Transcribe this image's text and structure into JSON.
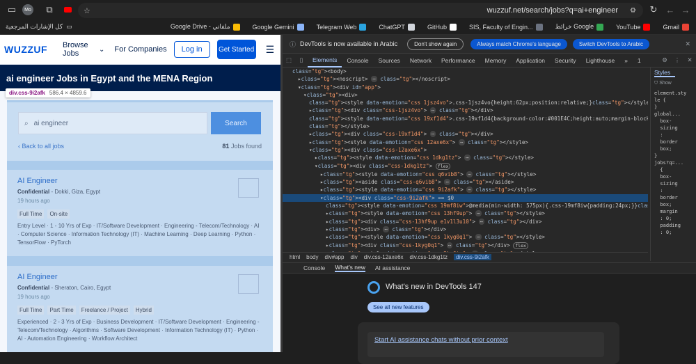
{
  "browser": {
    "url": "wuzzuf.net/search/jobs?q=ai+engineer",
    "bookmarks": [
      {
        "label": "Gmail",
        "color": "#ea4335"
      },
      {
        "label": "YouTube",
        "color": "#ff0000"
      },
      {
        "label": "خرائط Google",
        "color": "#34a853"
      },
      {
        "label": "SIS, Faculty of Engin...",
        "color": "#6b7280"
      },
      {
        "label": "GitHub",
        "color": "#ffffff"
      },
      {
        "label": "ChatGPT",
        "color": "#d1d5db"
      },
      {
        "label": "Telegram Web",
        "color": "#2aa3df"
      },
      {
        "label": "Google Gemini",
        "color": "#8ab4f8"
      },
      {
        "label": "Google Drive - ملفاتي",
        "color": "#fbbc04"
      }
    ],
    "all_bookmarks": "كل الإشارات المرجعية"
  },
  "wuzzuf": {
    "logo": "WUZZUF",
    "browse": "Browse Jobs",
    "companies": "For Companies",
    "login": "Log in",
    "get_started": "Get Started",
    "hero_title": "ai engineer Jobs in Egypt and the MENA Region",
    "inspect_selector": "div.css-9i2afk",
    "inspect_dims": "586.4 × 4859.6",
    "search_value": "ai engineer",
    "search_button": "Search",
    "back_link": "Back to all jobs",
    "found_count": "81",
    "found_label": "Jobs found",
    "jobs": [
      {
        "title": "AI Engineer",
        "company": "Confidential",
        "location": " - Dokki, Giza, Egypt",
        "age": "19 hours ago",
        "tags": [
          "Full Time",
          "On-site"
        ],
        "desc": "Entry Level · 1 - 10 Yrs of Exp · IT/Software Development · Engineering - Telecom/Technology · AI · Computer Science · Information Technology (IT) · Machine Learning · Deep Learning · Python · TensorFlow · PyTorch"
      },
      {
        "title": "AI Engineer",
        "company": "Confidential",
        "location": " - Sheraton, Cairo, Egypt",
        "age": "19 hours ago",
        "tags": [
          "Full Time",
          "Part Time",
          "Freelance / Project",
          "Hybrid"
        ],
        "desc": "Experienced · 2 - 3 Yrs of Exp · Business Development · IT/Software Development · Engineering - Telecom/Technology · Algorithms · Software Development · Information Technology (IT) · Python · AI · Automation Engineering · Workflow Architect"
      }
    ]
  },
  "devtools": {
    "banner": "DevTools is now available in Arabic",
    "dont_show": "Don't show again",
    "match_lang": "Always match Chrome's language",
    "switch_lang": "Switch DevTools to Arabic",
    "tabs": [
      "Elements",
      "Console",
      "Sources",
      "Network",
      "Performance",
      "Memory",
      "Application",
      "Security",
      "Lighthouse"
    ],
    "issues_count": "1",
    "breadcrumb": [
      "html",
      "body",
      "div#app",
      "div",
      "div.css-12axe6x",
      "div.css-1dkg1tz",
      "div.css-9i2afk"
    ],
    "styles_tab": "Styles",
    "styles_filter": "Show",
    "drawer_tabs": [
      "Console",
      "What's new",
      "AI assistance"
    ],
    "whatsnew_title": "What's new in DevTools 147",
    "see_features": "See all new features",
    "card_link": "Start AI assistance chats without prior context",
    "dom_lines": [
      {
        "ind": 0,
        "t": "<body>"
      },
      {
        "ind": 1,
        "t": "▸<noscript> ⋯ </noscript>"
      },
      {
        "ind": 1,
        "t": "▾<div id=\"app\">"
      },
      {
        "ind": 2,
        "t": "▾<div>"
      },
      {
        "ind": 3,
        "t": "<style data-emotion=\"css 1jsz4vo\">.css-1jsz4vo{height:62px;position:relative;}</style>"
      },
      {
        "ind": 3,
        "t": "▸<div class=\"css-1jsz4vo\"> ⋯ </div>"
      },
      {
        "ind": 3,
        "t": "<style data-emotion=\"css 19xf1d4\">.css-19xf1d4{background-color:#001E4C;height:auto;margin-block-end:24px;}"
      },
      {
        "ind": 3,
        "t": "</style>"
      },
      {
        "ind": 3,
        "t": "▸<div class=\"css-19xf1d4\"> ⋯ </div>"
      },
      {
        "ind": 3,
        "t": "▸<style data-emotion=\"css 12axe6x\"> ⋯ </style>"
      },
      {
        "ind": 3,
        "t": "▾<div class=\"css-12axe6x\">"
      },
      {
        "ind": 4,
        "t": "▸<style data-emotion=\"css 1dkg1tz\"> ⋯ </style>"
      },
      {
        "ind": 4,
        "t": "▾<div class=\"css-1dkg1tz\"> flex"
      },
      {
        "ind": 5,
        "t": "▸<style data-emotion=\"css q6vib8\"> ⋯ </style>"
      },
      {
        "ind": 5,
        "t": "▸<aside class=\"css-q6vib8\"> ⋯ </aside>"
      },
      {
        "ind": 5,
        "t": "▸<style data-emotion=\"css 9i2afk\"> ⋯ </style>"
      },
      {
        "ind": 5,
        "t": "▾<div class=\"css-9i2afk\"> == $0",
        "sel": true
      },
      {
        "ind": 6,
        "t": "<style data-emotion=\"css 19mf8iw\">@media(min-width: 575px){.css-19mf8iw{padding:24px;}}</style>"
      },
      {
        "ind": 6,
        "t": "▸<style data-emotion=\"css 13hf9up\"> ⋯ </style>"
      },
      {
        "ind": 6,
        "t": "▸<div class=\"css-13hf9up e1v1l3u10\"> ⋯ </div>"
      },
      {
        "ind": 6,
        "t": "▸<div> ⋯ </div>"
      },
      {
        "ind": 6,
        "t": "▸<style data-emotion=\"css 1kyg0q1\"> ⋯ </style>"
      },
      {
        "ind": 6,
        "t": "▸<div class=\"css-1kyg0q1\"> ⋯ </div> flex"
      },
      {
        "ind": 6,
        "t": "▸<style data-emotion=\"css 2kv6tz\"> ⋯ </style>"
      }
    ],
    "styles_lines": [
      "element.sty",
      "le {",
      "}",
      "global...",
      "  box-",
      "  sizing",
      "  :",
      "  border",
      "  box;",
      "}",
      "jobs?q=...",
      "  {",
      "  box-",
      "  sizing",
      "  :",
      "  border",
      "  box;",
      "  margin",
      "  : 0;",
      "  padding",
      "  : 0;"
    ]
  }
}
